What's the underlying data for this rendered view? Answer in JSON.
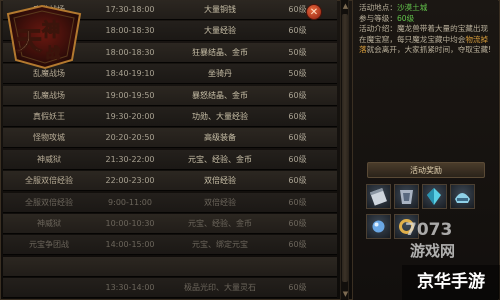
{
  "schedule": [
    {
      "name": "魔龙战场",
      "time": "17:30-18:00",
      "reward": "大量铜钱",
      "level": "60级",
      "dim": false
    },
    {
      "name": "经验",
      "time": "18:00-18:30",
      "reward": "大量经验",
      "level": "60级",
      "dim": false
    },
    {
      "name": "",
      "time": "18:00-18:30",
      "reward": "狂暴结晶、金币",
      "level": "50级",
      "dim": false
    },
    {
      "name": "乱魔战场",
      "time": "18:40-19:10",
      "reward": "坐骑丹",
      "level": "50级",
      "dim": false
    },
    {
      "name": "乱魔战场",
      "time": "19:00-19:50",
      "reward": "暴怒结晶、金币",
      "level": "60级",
      "dim": false
    },
    {
      "name": "真假妖王",
      "time": "19:30-20:00",
      "reward": "功勋、大量经验",
      "level": "60级",
      "dim": false
    },
    {
      "name": "怪物攻城",
      "time": "20:20-20:50",
      "reward": "高级装备",
      "level": "60级",
      "dim": false
    },
    {
      "name": "神威狱",
      "time": "21:30-22:00",
      "reward": "元宝、经验、金币",
      "level": "60级",
      "dim": false
    },
    {
      "name": "全服双倍经验",
      "time": "22:00-23:00",
      "reward": "双倍经验",
      "level": "60级",
      "dim": false
    },
    {
      "name": "全服双倍经验",
      "time": "9:00-11:00",
      "reward": "双倍经验",
      "level": "60级",
      "dim": true
    },
    {
      "name": "神威狱",
      "time": "10:00-10:30",
      "reward": "元宝、经验、金币",
      "level": "60级",
      "dim": true
    },
    {
      "name": "元宝争团战",
      "time": "14:00-15:00",
      "reward": "元宝、绑定元宝",
      "level": "60级",
      "dim": true
    },
    {
      "name": "",
      "time": "",
      "reward": "",
      "level": "",
      "dim": true
    },
    {
      "name": "",
      "time": "13:30-14:00",
      "reward": "极品光印、大量灵石",
      "level": "60级",
      "dim": true
    }
  ],
  "close_label": "✕",
  "info": {
    "location_label": "活动地点：",
    "location_value": "沙漠土城",
    "level_label": "参与等级：",
    "level_value": "60级",
    "desc_label": "活动介绍：",
    "desc_part1": "魔龙兽带着大量的宝藏出现在魔宝窟，每只魔龙宝藏中均会",
    "desc_highlight": "物流掉落",
    "desc_part2": "就会离开，大家抓紧时间，夺取宝藏!"
  },
  "reward_title": "活动奖励",
  "watermark": {
    "num": "7073",
    "txt": "游戏网",
    "site": "京华手游"
  },
  "colors": {
    "accent": "#62c24b",
    "close": "#c7401f"
  }
}
